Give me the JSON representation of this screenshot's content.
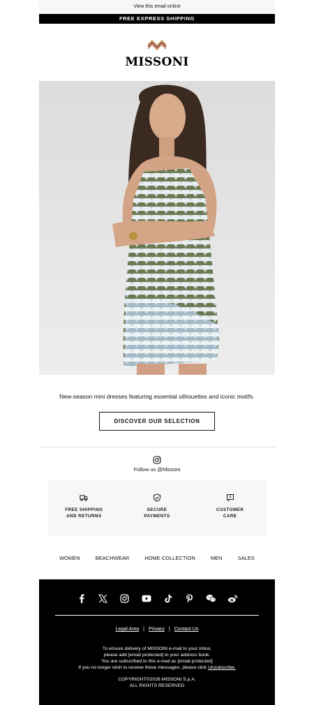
{
  "header": {
    "view_online": "View this email online",
    "shipping_banner": "FREE EXPRESS SHIPPING",
    "brand": "MISSONI",
    "logo_colors": [
      "#c8a25a",
      "#7a1f1f",
      "#1a1a1a"
    ]
  },
  "hero": {
    "tagline": "New-season mini dresses featuring essential silhouettes and iconic motifs.",
    "cta_label": "DISCOVER OUR SELECTION"
  },
  "social_follow": {
    "icon": "instagram-icon",
    "text": "Follow us @Missoni"
  },
  "services": [
    {
      "icon": "truck-icon",
      "label": "FREE SHIPPING\nAND RETURNS"
    },
    {
      "icon": "shield-check-icon",
      "label": "SECURE\nPAYMENTS"
    },
    {
      "icon": "help-chat-icon",
      "label": "CUSTOMER\nCARE"
    }
  ],
  "nav": [
    "WOMEN",
    "BEACHWEAR",
    "HOME COLLECTION",
    "MEN",
    "SALES"
  ],
  "footer": {
    "social_icons": [
      "facebook-icon",
      "x-icon",
      "instagram-icon",
      "youtube-icon",
      "tiktok-icon",
      "pinterest-icon",
      "wechat-icon",
      "weibo-icon"
    ],
    "legal_links": [
      "Legal Area",
      "Privacy",
      "Contact Us"
    ],
    "legal_separator": "|",
    "delivery_line1": "To ensure delivery of MISSONI e-mail to your inbox,",
    "delivery_line2": "please add [email protected] to your address book.",
    "delivery_line3": "You are subscribed to this e-mail as [email protected]",
    "delivery_line4_prefix": "If you no longer wish to receive these messages, please click",
    "unsubscribe": "Unsubscribe.",
    "copyright_line1": "COPYRIGHT©2026 MISSONI S.p.A.",
    "copyright_line2": "ALL RIGHTS RESERVED"
  }
}
